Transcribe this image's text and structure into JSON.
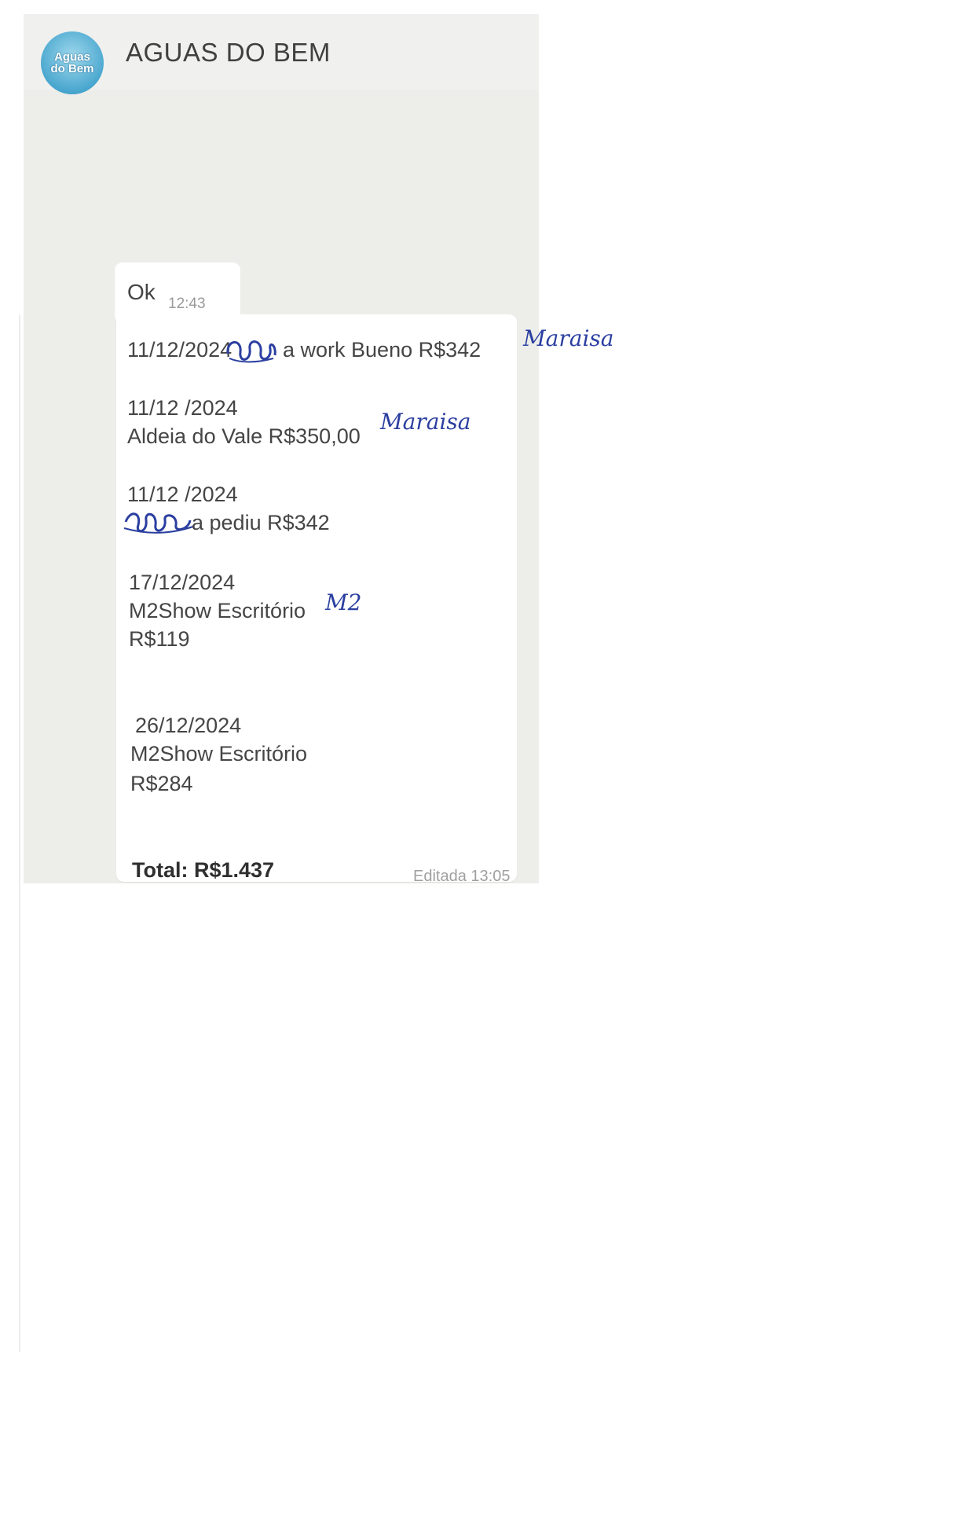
{
  "header": {
    "title": "AGUAS DO BEM",
    "avatar_line1": "Aguas",
    "avatar_line2": "do Bem"
  },
  "messages": {
    "ok": {
      "text": "Ok",
      "time": "12:43"
    },
    "main": {
      "lines": [
        "11/12/2024",
        "a work Bueno  R$342",
        "11/12 /2024",
        "Aldeia do Vale R$350,00",
        "11/12 /2024",
        "a pediu  R$342",
        "17/12/2024",
        "M2Show Escritório",
        "R$119",
        "26/12/2024",
        "M2Show Escritório",
        "R$284"
      ],
      "total": "Total: R$1.437",
      "edited_time": "Editada 13:05"
    }
  },
  "annotations": {
    "handwritten_1": "Maraisa",
    "handwritten_2": "Maraisa",
    "handwritten_3": "M2"
  },
  "colors": {
    "chat_background": "#ededea",
    "bubble": "#ffffff",
    "ink": "#2b3fa0",
    "avatar": "#4aa7cf"
  }
}
